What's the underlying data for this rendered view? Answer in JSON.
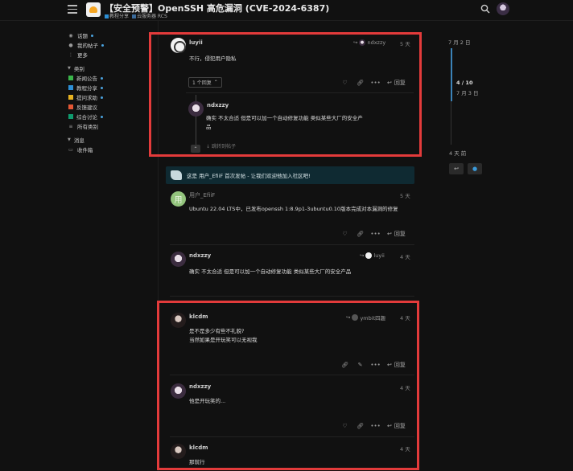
{
  "header": {
    "title": "【安全预警】OpenSSH 高危漏洞 (CVE-2024-6387)",
    "tags": [
      {
        "label": "教程分享",
        "color": "#2d8fd5"
      },
      {
        "label": "云服务器 RCS",
        "color": "#3a6a9a"
      }
    ]
  },
  "sidebar": {
    "items": [
      {
        "label": "话题",
        "icon": "topics-icon",
        "dot": true
      },
      {
        "label": "我的帖子",
        "icon": "user-icon",
        "dot": true
      },
      {
        "label": "更多",
        "icon": "more-icon",
        "dot": false
      }
    ],
    "categories_label": "类别",
    "categories": [
      {
        "label": "新闻公告",
        "color": "#3ab54a",
        "dot": true
      },
      {
        "label": "教程分享",
        "color": "#2d8fd5",
        "dot": true
      },
      {
        "label": "提问求助",
        "color": "#e8b321",
        "dot": true
      },
      {
        "label": "反馈建议",
        "color": "#e45735",
        "dot": false
      },
      {
        "label": "综合讨论",
        "color": "#0f9b6e",
        "dot": true
      },
      {
        "label": "所有类别",
        "color": "",
        "dot": false
      }
    ],
    "messages_label": "消息",
    "inbox_label": "收件箱"
  },
  "posts": {
    "p1": {
      "username": "luyii",
      "reply_to": "ndxzzy",
      "time": "5 天",
      "text": "不行，侵犯用户隐私",
      "replies_label": "1 个回复",
      "reply_label": "回复"
    },
    "p1_nested": {
      "username": "ndxzzy",
      "text_line1": "确实 不太合适 但是可以加一个自动修复功能 类似某些大厂的安全产",
      "text_line2": "品",
      "jump_label": "跳转到帖子"
    },
    "notice": "这是 用户_EfiiF 首次发帖 - 让我们欢迎他加入社区吧!",
    "p2": {
      "username": "用户_EfiiF",
      "avatar_letter": "用",
      "time": "5 天",
      "text": "Ubuntu 22.04 LTS中，已发布openssh 1:8.9p1-3ubuntu0.10版本完成对本漏洞的修复",
      "reply_label": "回复"
    },
    "p3": {
      "username": "ndxzzy",
      "reply_to": "luyii",
      "time": "4 天",
      "text": "确实 不太合适 但是可以加一个自动修复功能 类似某些大厂的安全产品",
      "reply_label": "回复"
    },
    "p4": {
      "username": "klcdm",
      "reply_to": "ymbit四趣",
      "time": "4 天",
      "text_line1": "是不是多少有些不礼貌?",
      "text_line2": "当然如果是开玩笑可以无视我",
      "reply_label": "回复"
    },
    "p5": {
      "username": "ndxzzy",
      "time": "4 天",
      "text": "他是开玩笑的...",
      "reply_label": "回复"
    },
    "p6": {
      "username": "klcdm",
      "time": "4 天",
      "text": "那就行"
    }
  },
  "timeline": {
    "start_date": "7 月 2 日",
    "position": "4 / 10",
    "position_date": "7 月 3 日",
    "end_date": "4 天 前",
    "progress_fraction": 0.4
  }
}
